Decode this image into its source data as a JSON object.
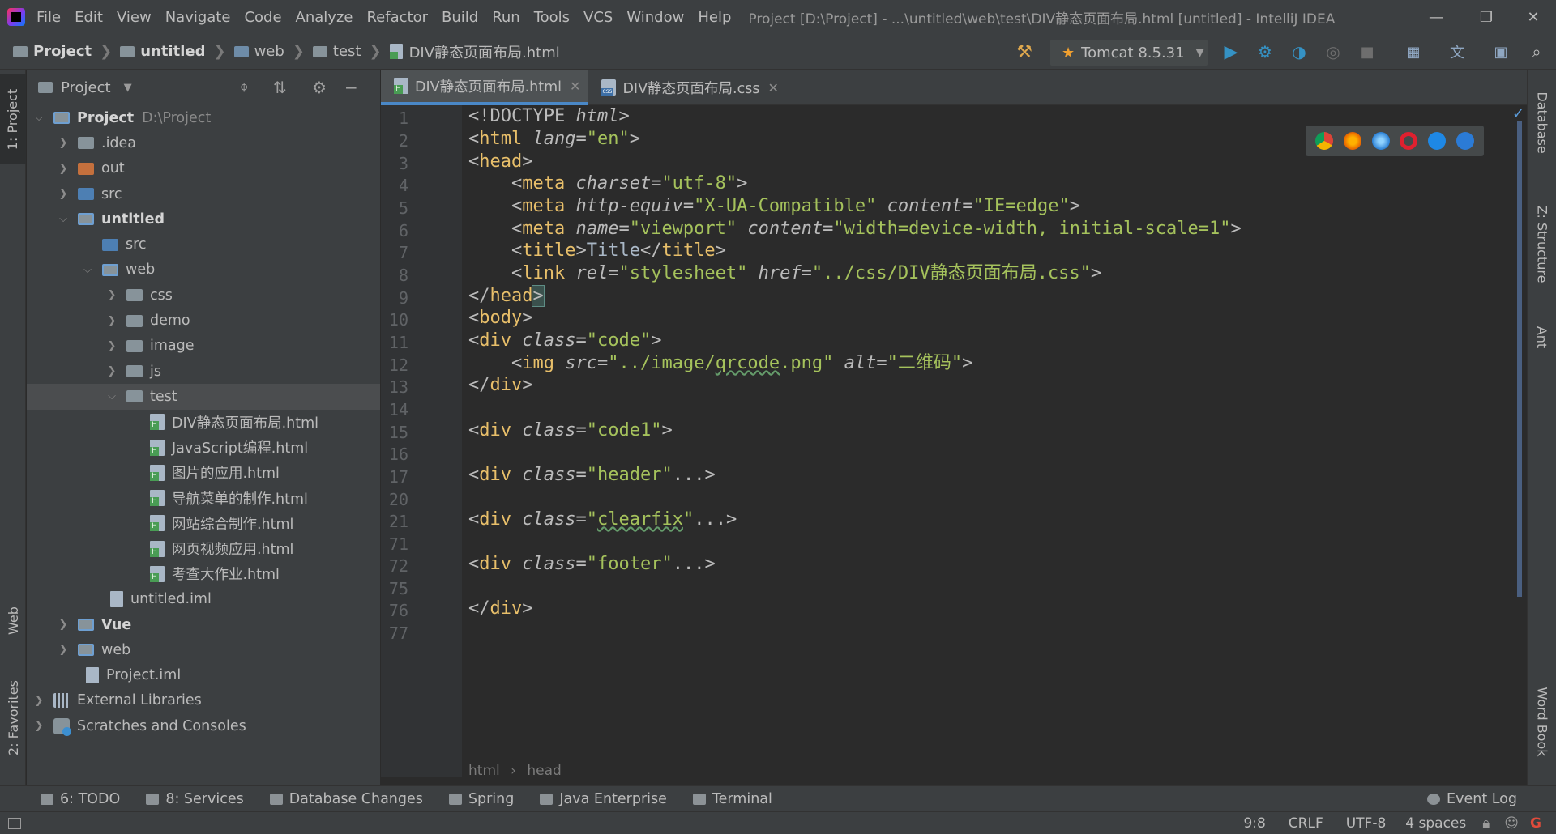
{
  "menubar": {
    "items": [
      "File",
      "Edit",
      "View",
      "Navigate",
      "Code",
      "Analyze",
      "Refactor",
      "Build",
      "Run",
      "Tools",
      "VCS",
      "Window",
      "Help"
    ],
    "window_title": "Project [D:\\Project] - ...\\untitled\\web\\test\\DIV静态页面布局.html [untitled] - IntelliJ IDEA"
  },
  "navbar": {
    "crumbs": [
      "Project",
      "untitled",
      "web",
      "test",
      "DIV静态页面布局.html"
    ],
    "run_config": "Tomcat 8.5.31"
  },
  "project_panel": {
    "title": "Project",
    "tree": [
      {
        "label": "Project",
        "note": "D:\\Project"
      },
      {
        "label": ".idea"
      },
      {
        "label": "out"
      },
      {
        "label": "src"
      },
      {
        "label": "untitled"
      },
      {
        "label": "src"
      },
      {
        "label": "web"
      },
      {
        "label": "css"
      },
      {
        "label": "demo"
      },
      {
        "label": "image"
      },
      {
        "label": "js"
      },
      {
        "label": "test"
      },
      {
        "label": "DIV静态页面布局.html"
      },
      {
        "label": "JavaScript编程.html"
      },
      {
        "label": "图片的应用.html"
      },
      {
        "label": "导航菜单的制作.html"
      },
      {
        "label": "网站综合制作.html"
      },
      {
        "label": "网页视频应用.html"
      },
      {
        "label": "考查大作业.html"
      },
      {
        "label": "untitled.iml"
      },
      {
        "label": "Vue"
      },
      {
        "label": "web"
      },
      {
        "label": "Project.iml"
      },
      {
        "label": "External Libraries"
      },
      {
        "label": "Scratches and Consoles"
      }
    ]
  },
  "left_tabs": {
    "project": "1: Project",
    "web": "Web",
    "favorites": "2: Favorites"
  },
  "right_tabs": {
    "database": "Database",
    "structure": "Z: Structure",
    "ant": "Ant",
    "wordbook": "Word Book"
  },
  "editor": {
    "tabs": [
      "DIV静态页面布局.html",
      "DIV静态页面布局.css"
    ],
    "line_numbers": [
      "1",
      "2",
      "3",
      "4",
      "5",
      "6",
      "7",
      "8",
      "9",
      "10",
      "11",
      "12",
      "13",
      "14",
      "15",
      "16",
      "17",
      "20",
      "21",
      "71",
      "72",
      "75",
      "76",
      "77"
    ],
    "breadcrumb": [
      "html",
      "head"
    ]
  },
  "bottom_tabs": [
    "6: TODO",
    "8: Services",
    "Database Changes",
    "Spring",
    "Java Enterprise",
    "Terminal"
  ],
  "event_log": "Event Log",
  "status": {
    "position": "9:8",
    "line_sep": "CRLF",
    "encoding": "UTF-8",
    "indent": "4 spaces"
  },
  "colors": {
    "accent": "#4a88c7",
    "tag": "#e8bf6a",
    "string": "#a5c25c",
    "background": "#2b2b2b"
  }
}
